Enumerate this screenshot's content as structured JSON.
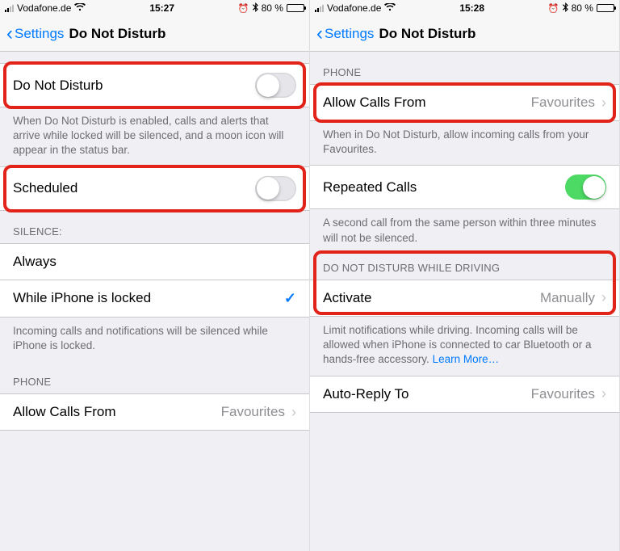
{
  "left": {
    "status": {
      "carrier": "Vodafone.de",
      "time": "15:27",
      "battery_pct": "80 %"
    },
    "nav": {
      "back": "Settings",
      "title": "Do Not Disturb"
    },
    "dnd": {
      "label": "Do Not Disturb",
      "footer": "When Do Not Disturb is enabled, calls and alerts that arrive while locked will be silenced, and a moon icon will appear in the status bar."
    },
    "scheduled": {
      "label": "Scheduled"
    },
    "silence": {
      "header": "SILENCE:",
      "always": "Always",
      "locked": "While iPhone is locked",
      "footer": "Incoming calls and notifications will be silenced while iPhone is locked."
    },
    "phone": {
      "header": "PHONE",
      "allow_label": "Allow Calls From",
      "allow_value": "Favourites"
    }
  },
  "right": {
    "status": {
      "carrier": "Vodafone.de",
      "time": "15:28",
      "battery_pct": "80 %"
    },
    "nav": {
      "back": "Settings",
      "title": "Do Not Disturb"
    },
    "phone": {
      "header": "PHONE",
      "allow_label": "Allow Calls From",
      "allow_value": "Favourites",
      "allow_footer": "When in Do Not Disturb, allow incoming calls from your Favourites."
    },
    "repeated": {
      "label": "Repeated Calls",
      "footer": "A second call from the same person within three minutes will not be silenced."
    },
    "driving": {
      "header": "DO NOT DISTURB WHILE DRIVING",
      "activate_label": "Activate",
      "activate_value": "Manually",
      "footer_text": "Limit notifications while driving. Incoming calls will be allowed when iPhone is connected to car Bluetooth or a hands-free accessory. ",
      "learn_more": "Learn More…"
    },
    "autoreply": {
      "label": "Auto-Reply To",
      "value": "Favourites"
    }
  }
}
